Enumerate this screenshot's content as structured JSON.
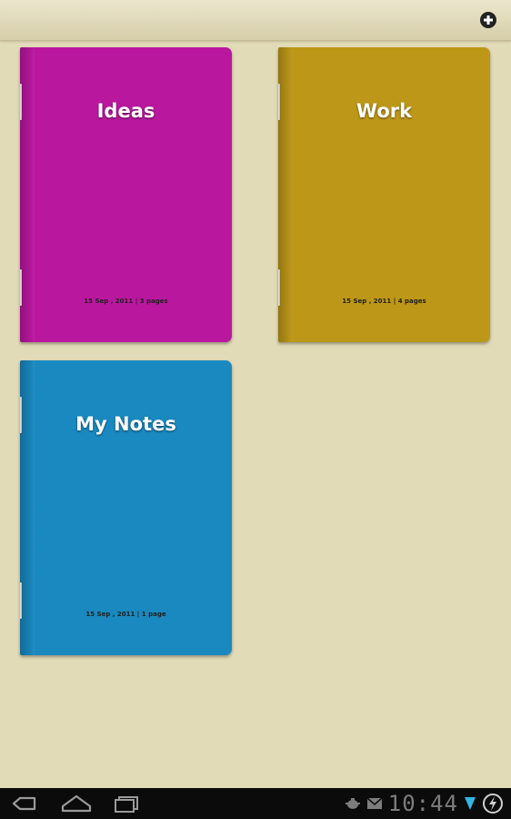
{
  "action_bar": {
    "add_icon": "add-circle-icon"
  },
  "notebooks": [
    {
      "title": "Ideas",
      "meta": "15 Sep , 2011 | 3 pages",
      "color": "#ba179f"
    },
    {
      "title": "Work",
      "meta": "15 Sep , 2011 | 4 pages",
      "color": "#bd9717"
    },
    {
      "title": "My Notes",
      "meta": "15 Sep , 2011 | 1 page",
      "color": "#1a89bf"
    }
  ],
  "system_bar": {
    "back_icon": "back-icon",
    "home_icon": "home-icon",
    "recents_icon": "recent-apps-icon",
    "usb_icon": "usb-debug-icon",
    "mail_icon": "mail-icon",
    "clock": "10:44",
    "signal_icon": "wifi-signal-icon",
    "battery_icon": "battery-charging-icon",
    "accent": "#33b5e5"
  }
}
